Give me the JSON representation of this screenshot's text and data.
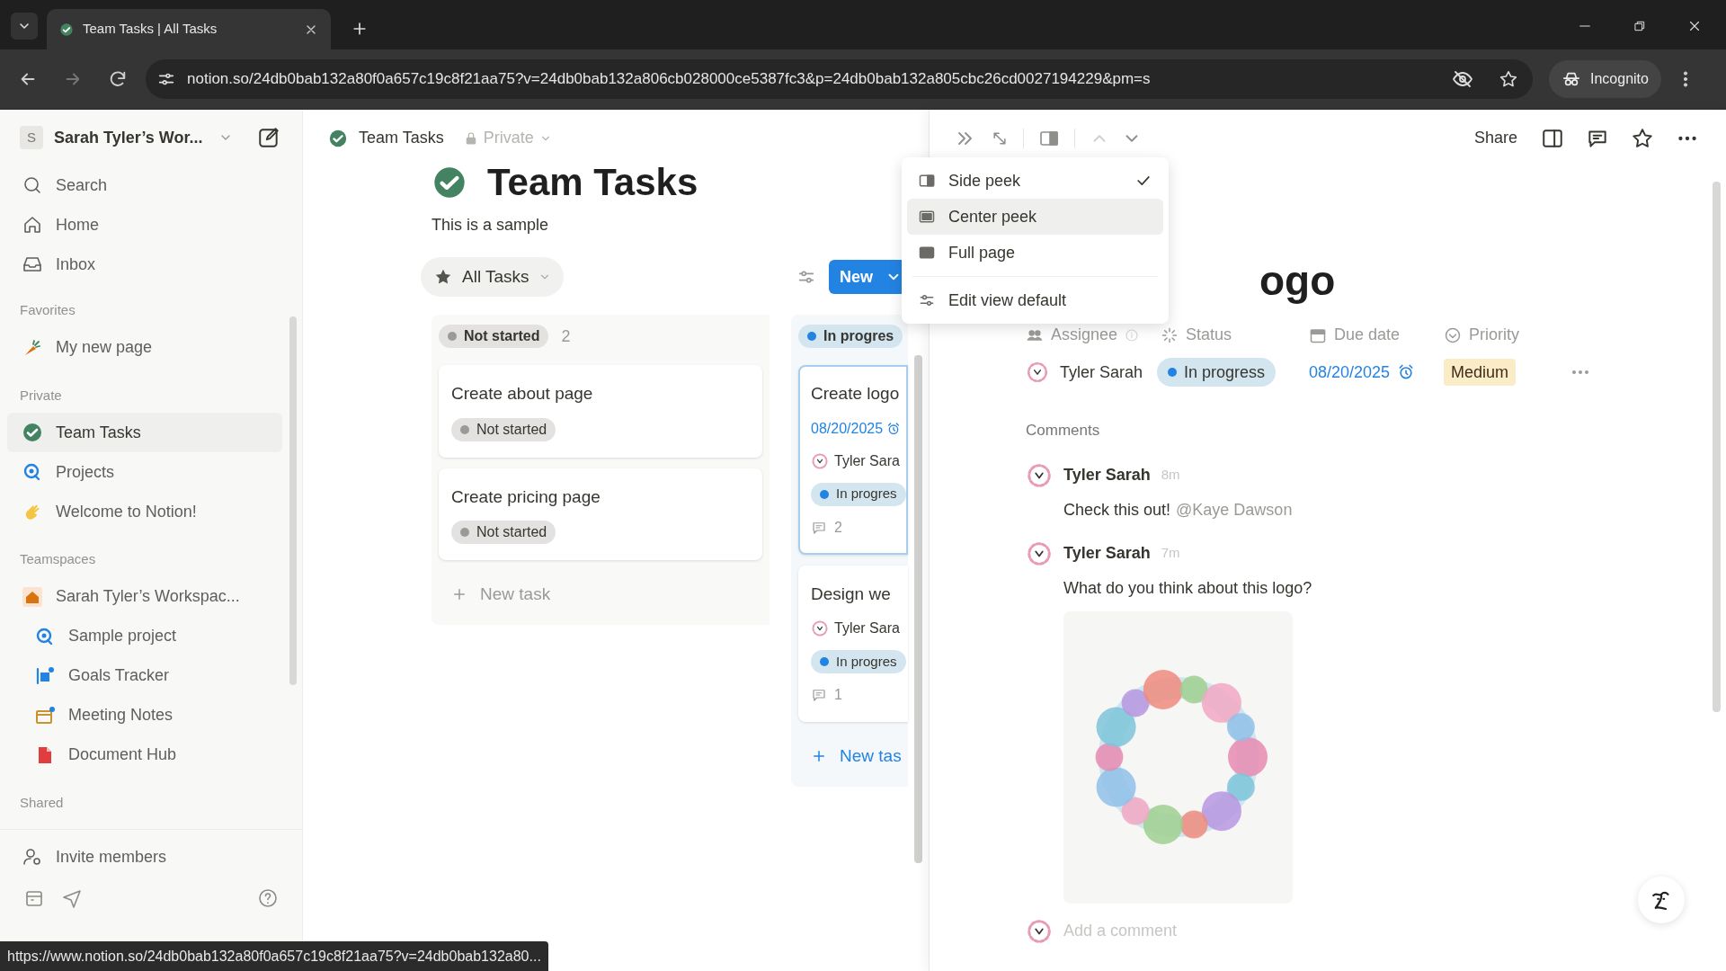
{
  "browser": {
    "tab_title": "Team Tasks | All Tasks",
    "url": "notion.so/24db0bab132a80f0a657c19c8f21aa75?v=24db0bab132a806cb028000ce5387fc3&p=24db0bab132a805cbc26cd0027194229&pm=s",
    "profile_label": "Incognito"
  },
  "sidebar": {
    "workspace_initial": "S",
    "workspace_name": "Sarah Tyler’s Wor...",
    "nav": [
      {
        "label": "Search",
        "kind": "search"
      },
      {
        "label": "Home",
        "kind": "home"
      },
      {
        "label": "Inbox",
        "kind": "inbox"
      }
    ],
    "sections": [
      {
        "title": "Favorites",
        "items": [
          {
            "label": "My new page",
            "kind": "carrot",
            "selected": false
          }
        ]
      },
      {
        "title": "Private",
        "items": [
          {
            "label": "Team Tasks",
            "kind": "check",
            "selected": true
          },
          {
            "label": "Projects",
            "kind": "target",
            "selected": false
          },
          {
            "label": "Welcome to Notion!",
            "kind": "wave",
            "selected": false
          }
        ]
      },
      {
        "title": "Teamspaces",
        "items": [
          {
            "label": "Sarah Tyler’s Workspac...",
            "kind": "house",
            "selected": false,
            "children": [
              {
                "label": "Sample project",
                "kind": "target",
                "selected": false
              },
              {
                "label": "Goals Tracker",
                "kind": "goals",
                "selected": false
              },
              {
                "label": "Meeting Notes",
                "kind": "calendar",
                "selected": false
              },
              {
                "label": "Document Hub",
                "kind": "document",
                "selected": false
              }
            ]
          }
        ]
      },
      {
        "title": "Shared"
      }
    ],
    "invite": "Invite members"
  },
  "page_header": {
    "title": "Team Tasks",
    "privacy": "Private"
  },
  "page": {
    "title": "Team Tasks",
    "description": "This is a sample",
    "view": "All Tasks",
    "new_button": "New"
  },
  "board": {
    "columns": [
      {
        "title": "Not started",
        "color": "#9b9a97",
        "count": "2",
        "add_label": "New task",
        "cards": [
          {
            "title": "Create about page",
            "status": "Not started",
            "selected": false
          },
          {
            "title": "Create pricing page",
            "status": "Not started",
            "selected": false
          }
        ]
      },
      {
        "title": "In progres",
        "color": "#2383e2",
        "add_label": "New tas",
        "cards": [
          {
            "title": "Create logo",
            "date": "08/20/2025",
            "assignee": "Tyler Sara",
            "status": "In progres",
            "comments": "2",
            "selected": true
          },
          {
            "title": "Design we",
            "assignee": "Tyler Sara",
            "status": "In progres",
            "comments": "1",
            "selected": false
          }
        ]
      }
    ]
  },
  "view_menu": {
    "items": [
      {
        "label": "Side peek",
        "kind": "side",
        "checked": true,
        "highlighted": false
      },
      {
        "label": "Center peek",
        "kind": "center",
        "checked": false,
        "highlighted": true
      },
      {
        "label": "Full page",
        "kind": "full",
        "checked": false,
        "highlighted": false
      },
      {
        "label": "Edit view default",
        "kind": "settings",
        "checked": false,
        "highlighted": false
      }
    ]
  },
  "peek": {
    "share": "Share",
    "title": "ogo",
    "properties": [
      {
        "label": "Assignee",
        "kind": "person",
        "value": "Tyler Sarah"
      },
      {
        "label": "Status",
        "kind": "status",
        "value": "In progress",
        "color": "#2383e2"
      },
      {
        "label": "Due date",
        "kind": "date",
        "value": "08/20/2025"
      },
      {
        "label": "Priority",
        "kind": "priority",
        "value": "Medium"
      }
    ],
    "comments_label": "Comments",
    "comments": [
      {
        "author": "Tyler Sarah",
        "time": "8m",
        "text": "Check this out!",
        "mention": "@Kaye Dawson",
        "image": false
      },
      {
        "author": "Tyler Sarah",
        "time": "7m",
        "text": "What do you think about this logo?",
        "image": true
      }
    ],
    "comment_placeholder": "Add a comment"
  },
  "status_url": "https://www.notion.so/24db0bab132a80f0a657c19c8f21aa75?v=24db0bab132a80..."
}
